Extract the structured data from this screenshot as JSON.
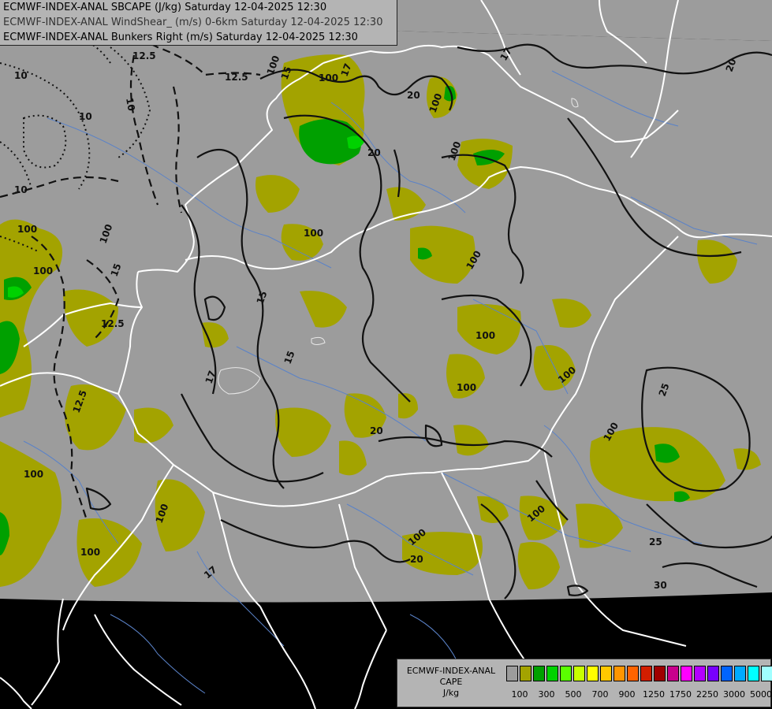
{
  "header": {
    "lines": [
      "ECMWF-INDEX-ANAL SBCAPE (J/kg) Saturday 12-04-2025 12:30",
      "ECMWF-INDEX-ANAL WindShear_ (m/s) 0-6km Saturday 12-04-2025 12:30",
      "ECMWF-INDEX-ANAL Bunkers Right (m/s) Saturday 12-04-2025 12:30"
    ]
  },
  "legend": {
    "title_line1": "ECMWF-INDEX-ANAL",
    "title_line2": "CAPE",
    "title_line3": "J/kg",
    "colors": [
      "#9c9c9c",
      "#a3a300",
      "#00a000",
      "#00d200",
      "#5aff00",
      "#c8ff00",
      "#ffff00",
      "#ffc800",
      "#ff9600",
      "#ff6400",
      "#d21e00",
      "#a00000",
      "#c8008c",
      "#ff00ff",
      "#b400ff",
      "#7800ff",
      "#0064ff",
      "#00aaff",
      "#00ffff",
      "#a0ffff",
      "#ffffff"
    ],
    "labels": [
      "100",
      "300",
      "500",
      "700",
      "900",
      "1250",
      "1750",
      "2250",
      "3000",
      "5000"
    ]
  },
  "map": {
    "colors": {
      "domain": "#9c9c9c",
      "outside": "#000000",
      "cape100": "#a3a300",
      "cape300": "#00a000",
      "cape500": "#00d200",
      "border": "#ffffff",
      "river": "#5a82c8",
      "contour": "#111111"
    },
    "contour_labels": [
      "12.5",
      "12.5",
      "10",
      "10",
      "10",
      "10",
      "15",
      "17",
      "20",
      "20",
      "100",
      "100",
      "100",
      "100",
      "100",
      "100",
      "100",
      "100",
      "100",
      "15",
      "15",
      "17",
      "17",
      "20",
      "20",
      "25",
      "25",
      "30",
      "100",
      "100",
      "100",
      "100",
      "100",
      "100",
      "12.5",
      "12.5",
      "15",
      "20",
      "17",
      "100",
      "100",
      "100"
    ]
  }
}
